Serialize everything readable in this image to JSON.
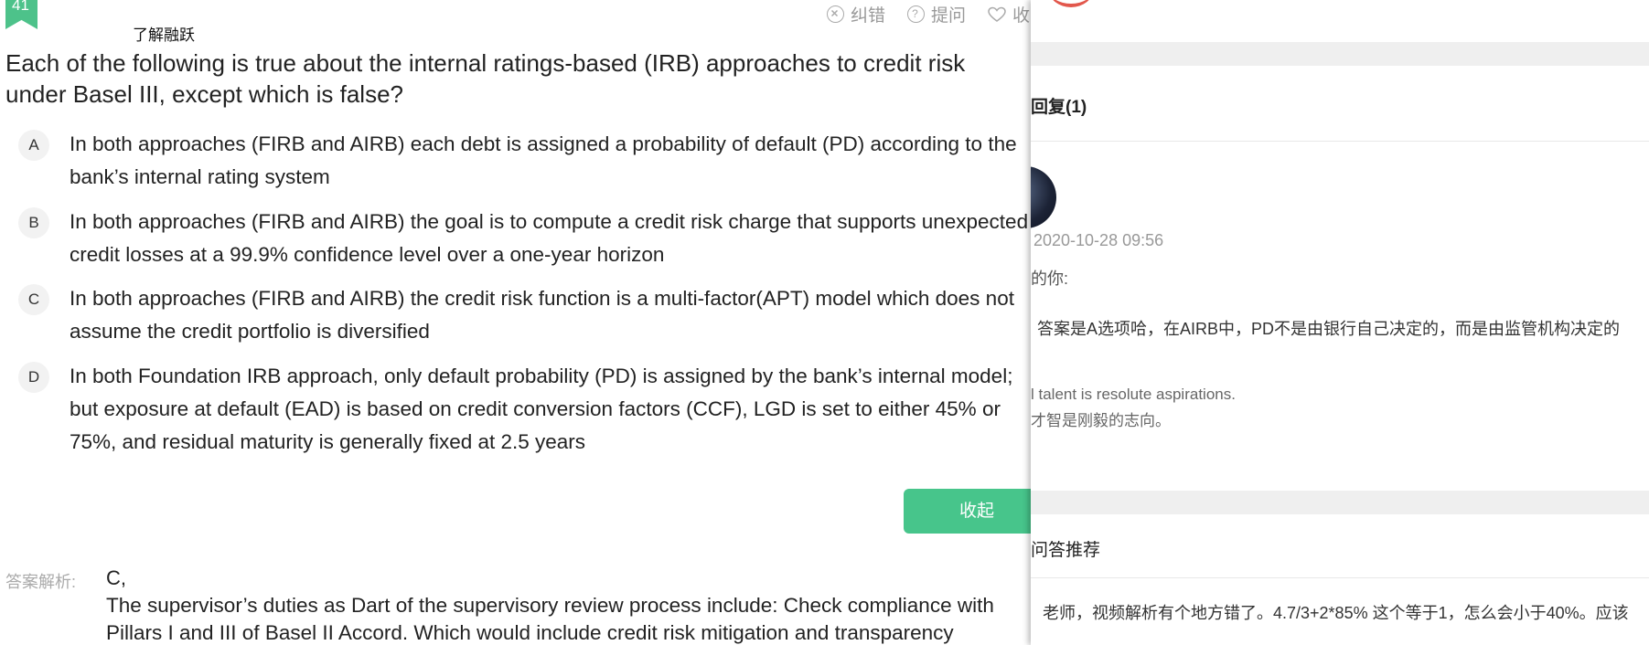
{
  "question": {
    "number": "41",
    "category": "了解融跃",
    "toolbar": [
      {
        "label": "纠错",
        "icon": "close-circle-icon"
      },
      {
        "label": "提问",
        "icon": "question-circle-icon"
      },
      {
        "label": "收",
        "icon": "heart-icon"
      }
    ],
    "text": "Each of the following is true about the internal ratings-based (IRB) approaches to credit risk under Basel III, except which is false?",
    "options": [
      {
        "letter": "A",
        "text": "In both approaches (FIRB and AIRB) each debt is assigned a probability of default (PD) according to the bank’s internal rating system"
      },
      {
        "letter": "B",
        "text": "In both approaches (FIRB and AIRB) the goal is to compute a credit risk charge that supports unexpected credit losses at a 99.9% confidence level over a one-year horizon"
      },
      {
        "letter": "C",
        "text": "In both approaches (FIRB and AIRB) the credit risk function is a multi-factor(APT) model which does not assume the credit portfolio is diversified"
      },
      {
        "letter": "D",
        "text": "In both Foundation IRB approach, only default probability (PD) is assigned by the bank’s internal model; but exposure at default (EAD) is based on credit conversion factors (CCF), LGD is set to either 45% or 75%, and residual maturity is generally fixed at 2.5 years"
      }
    ],
    "collapse_button": "收起",
    "analysis_label": "答案解析:",
    "answer": "C,",
    "analysis_lines": [
      "The supervisor’s duties as Dart of the supervisory review process include: Check compliance with",
      "Pillars I and III of Basel II Accord. Which would include credit risk mitigation and transparency"
    ]
  },
  "panel": {
    "replies_title": "回复(1)",
    "reply": {
      "timestamp": "2020-10-28 09:56",
      "greeting": "的你:",
      "content": "答案是A选项哈，在AIRB中，PD不是由银行自己决定的，而是由监管机构决定的",
      "signature_en": "l talent is resolute aspirations.",
      "signature_cn": "才智是刚毅的志向。"
    },
    "recommend_title": "问答推荐",
    "recommend_item": "老师，视频解析有个地方错了。4.7/3+2*85% 这个等于1，怎么会小于40%。应该"
  }
}
